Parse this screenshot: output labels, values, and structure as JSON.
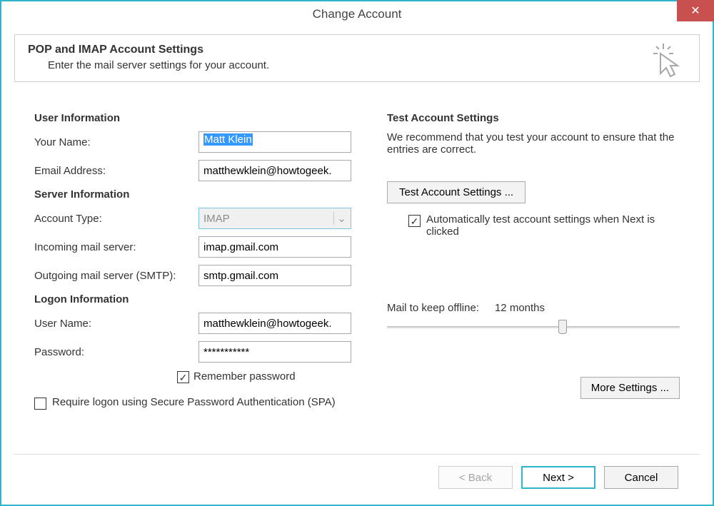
{
  "window": {
    "title": "Change Account"
  },
  "header": {
    "title": "POP and IMAP Account Settings",
    "subtitle": "Enter the mail server settings for your account."
  },
  "left": {
    "user_info_heading": "User Information",
    "your_name_label": "Your Name:",
    "your_name_value": "Matt Klein",
    "email_label": "Email Address:",
    "email_value": "matthewklein@howtogeek.",
    "server_info_heading": "Server Information",
    "account_type_label": "Account Type:",
    "account_type_value": "IMAP",
    "incoming_label": "Incoming mail server:",
    "incoming_value": "imap.gmail.com",
    "outgoing_label": "Outgoing mail server (SMTP):",
    "outgoing_value": "smtp.gmail.com",
    "logon_heading": "Logon Information",
    "user_name_label": "User Name:",
    "user_name_value": "matthewklein@howtogeek.",
    "password_label": "Password:",
    "password_value": "***********",
    "remember_label": "Remember password",
    "spa_label": "Require logon using Secure Password Authentication (SPA)"
  },
  "right": {
    "test_heading": "Test Account Settings",
    "test_desc": "We recommend that you test your account to ensure that the entries are correct.",
    "test_button": "Test Account Settings ...",
    "auto_test_label": "Automatically test account settings when Next is clicked",
    "mail_offline_label": "Mail to keep offline:",
    "mail_offline_value": "12 months",
    "more_settings": "More Settings ..."
  },
  "footer": {
    "back": "< Back",
    "next": "Next >",
    "cancel": "Cancel"
  }
}
